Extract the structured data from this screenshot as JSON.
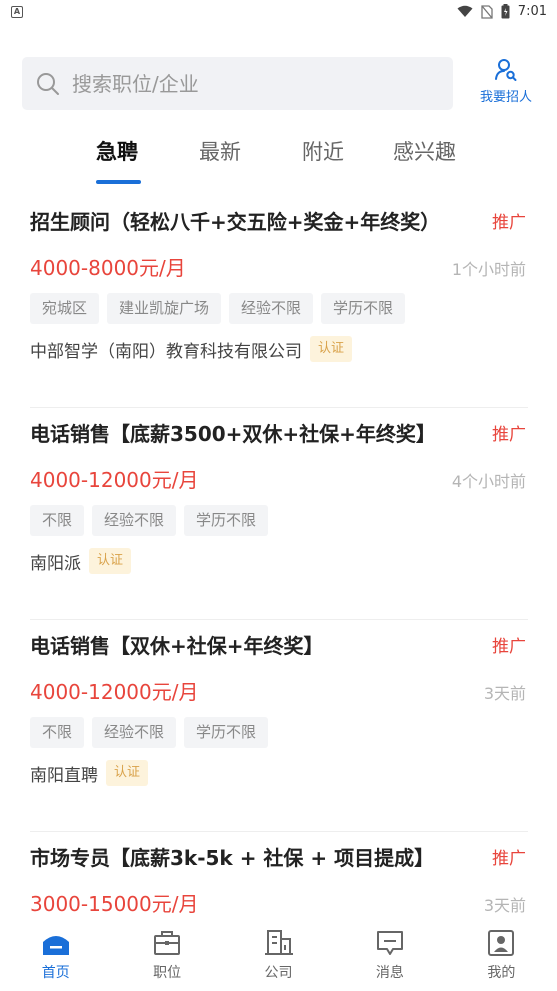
{
  "status_bar": {
    "time": "7:01",
    "app_icon_letter": "A"
  },
  "search": {
    "placeholder": "搜索职位/企业",
    "value": ""
  },
  "recruit": {
    "label": "我要招人"
  },
  "tabs": [
    {
      "label": "急聘",
      "active": true
    },
    {
      "label": "最新",
      "active": false
    },
    {
      "label": "附近",
      "active": false
    },
    {
      "label": "感兴趣",
      "active": false
    }
  ],
  "jobs": [
    {
      "title": "招生顾问（轻松八千+交五险+奖金+年终奖）",
      "promo": "推广",
      "salary": "4000-8000元/月",
      "time": "1个小时前",
      "tags": [
        "宛城区",
        "建业凯旋广场",
        "经验不限",
        "学历不限"
      ],
      "company": "中部智学（南阳）教育科技有限公司",
      "verified": "认证"
    },
    {
      "title": "电话销售【底薪3500+双休+社保+年终奖】",
      "promo": "推广",
      "salary": "4000-12000元/月",
      "time": "4个小时前",
      "tags": [
        "不限",
        "经验不限",
        "学历不限"
      ],
      "company": "南阳派",
      "verified": "认证"
    },
    {
      "title": "电话销售【双休+社保+年终奖】",
      "promo": "推广",
      "salary": "4000-12000元/月",
      "time": "3天前",
      "tags": [
        "不限",
        "经验不限",
        "学历不限"
      ],
      "company": "南阳直聘",
      "verified": "认证"
    },
    {
      "title": "市场专员【底薪3k-5k + 社保 + 项目提成】",
      "promo": "推广",
      "salary": "3000-15000元/月",
      "time": "3天前",
      "tags": [],
      "company": "",
      "verified": ""
    }
  ],
  "bottom_nav": [
    {
      "label": "首页",
      "icon": "home-icon",
      "active": true
    },
    {
      "label": "职位",
      "icon": "briefcase-icon",
      "active": false
    },
    {
      "label": "公司",
      "icon": "building-icon",
      "active": false
    },
    {
      "label": "消息",
      "icon": "message-icon",
      "active": false
    },
    {
      "label": "我的",
      "icon": "profile-icon",
      "active": false
    }
  ],
  "colors": {
    "accent": "#1a6fd8",
    "salary": "#e8453c",
    "verified_bg": "#fdf3dc",
    "verified_text": "#d9a24a"
  }
}
